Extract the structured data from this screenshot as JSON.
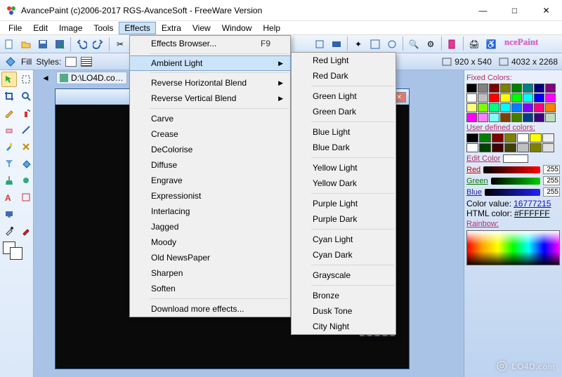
{
  "window": {
    "title": "AvancePaint (c)2006-2017 RGS-AvanceSoft - FreeWare Version",
    "min": "—",
    "max": "□",
    "close": "✕"
  },
  "menubar": [
    "File",
    "Edit",
    "Image",
    "Tools",
    "Effects",
    "Extra",
    "View",
    "Window",
    "Help"
  ],
  "menubar_open_index": 4,
  "toolbar": {
    "logo": "ncePaint"
  },
  "optbar": {
    "fill_label": "Fill",
    "styles_label": "Styles:",
    "dim1": "920 x 540",
    "dim2": "4032 x 2268"
  },
  "doc": {
    "tab": "D:\\LO4D.co…"
  },
  "right": {
    "fixed_title": "Fixed Colors:",
    "fixed_colors": [
      "#000000",
      "#808080",
      "#800000",
      "#808000",
      "#008000",
      "#008080",
      "#000080",
      "#800080",
      "#ffffff",
      "#c0c0c0",
      "#ff0000",
      "#ffff00",
      "#00ff00",
      "#00ffff",
      "#0000ff",
      "#ff00ff",
      "#ffff80",
      "#80ff00",
      "#00ff80",
      "#00ffff",
      "#0080ff",
      "#8000ff",
      "#ff0080",
      "#ff8000",
      "#ff00ff",
      "#ff80ff",
      "#80ffff",
      "#804000",
      "#408000",
      "#004080",
      "#400080",
      "#c0dcc0"
    ],
    "user_title": "User defined colors:",
    "user_colors": [
      "#000000",
      "#008000",
      "#800000",
      "#808000",
      "#ffffff",
      "#ffff00",
      "#f0f0f0",
      "#ffffff",
      "#004000",
      "#400000",
      "#404000",
      "#c0c0c0",
      "#808000",
      "#e0e0e0"
    ],
    "edit_title": "Edit Color",
    "red_label": "Red",
    "red_val": "255",
    "green_label": "Green",
    "green_val": "255",
    "blue_label": "Blue",
    "blue_val": "255",
    "color_value_label": "Color value:",
    "color_value": "16777215",
    "html_label": "HTML color:",
    "html_value": "#FFFFFF",
    "rainbow_title": "Rainbow:"
  },
  "effects_menu": {
    "browser": "Effects Browser...",
    "browser_sc": "F9",
    "ambient": "Ambient Light",
    "rhb": "Reverse Horizontal Blend",
    "rvb": "Reverse Vertical Blend",
    "items": [
      "Carve",
      "Crease",
      "DeColorise",
      "Diffuse",
      "Engrave",
      "Expressionist",
      "Interlacing",
      "Jagged",
      "Moody",
      "Old NewsPaper",
      "Sharpen",
      "Soften"
    ],
    "download": "Download more effects..."
  },
  "ambient_submenu": {
    "groups": [
      [
        "Red Light",
        "Red Dark"
      ],
      [
        "Green Light",
        "Green Dark"
      ],
      [
        "Blue Light",
        "Blue Dark"
      ],
      [
        "Yellow Light",
        "Yellow Dark"
      ],
      [
        "Purple Light",
        "Purple Dark"
      ],
      [
        "Cyan Light",
        "Cyan Dark"
      ],
      [
        "Grayscale"
      ],
      [
        "Bronze",
        "Dusk Tone",
        "City Night"
      ]
    ]
  },
  "watermark": {
    "host": "LO4D",
    "suffix": ".com"
  }
}
